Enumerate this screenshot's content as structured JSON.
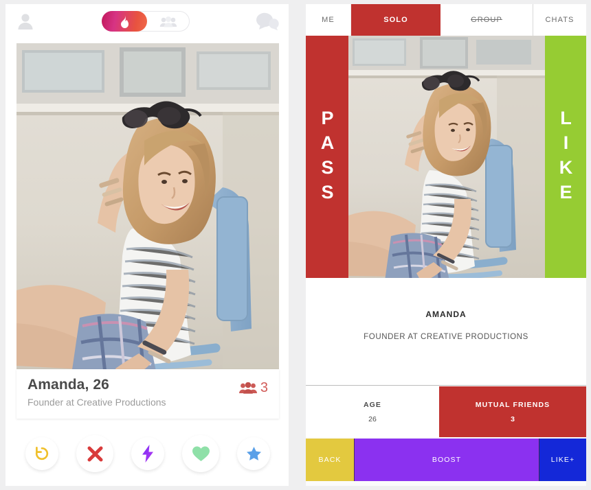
{
  "left_app": {
    "header": {
      "profile_icon": "person-icon",
      "chat_icon": "chat-bubbles-icon",
      "toggle": {
        "active_icon": "flame-icon",
        "inactive_icon": "group-people-icon"
      }
    },
    "card": {
      "name_line": "Amanda, 26",
      "sub_line": "Founder at Creative Productions",
      "mutual_friends_icon": "group-people-icon",
      "mutual_friends_count": "3",
      "photo_alt": "woman-seated-in-blue-chair-holding-sunglasses"
    },
    "actions": [
      {
        "name": "rewind-button",
        "icon": "rewind-icon",
        "color": "#f0c02c"
      },
      {
        "name": "nope-button",
        "icon": "x-icon",
        "color": "#d93b3b"
      },
      {
        "name": "boost-button",
        "icon": "lightning-bolt-icon",
        "color": "#9b32f0"
      },
      {
        "name": "like-button",
        "icon": "heart-icon",
        "color": "#8fe0a8"
      },
      {
        "name": "superlike-button",
        "icon": "star-icon",
        "color": "#5aa0e8"
      }
    ]
  },
  "right_app": {
    "tabs": [
      {
        "label": "ME",
        "state": "inactive"
      },
      {
        "label": "SOLO",
        "state": "active"
      },
      {
        "label": "GROUP",
        "state": "disabled"
      },
      {
        "label": "CHATS",
        "state": "inactive"
      }
    ],
    "hero": {
      "pass_label": "PASS",
      "like_label": "LIKE",
      "photo_alt": "woman-seated-in-blue-chair-holding-sunglasses"
    },
    "bio": {
      "name": "AMANDA",
      "role": "FOUNDER AT CREATIVE PRODUCTIONS"
    },
    "stats": [
      {
        "label": "AGE",
        "value": "26"
      },
      {
        "label": "MUTUAL FRIENDS",
        "value": "3"
      }
    ],
    "bottom_bar": [
      {
        "label": "BACK",
        "color": "#e3c93f"
      },
      {
        "label": "BOOST",
        "color": "#8b31f0"
      },
      {
        "label": "LIKE+",
        "color": "#1428d8"
      }
    ]
  },
  "colors": {
    "brand_red": "#c0322f",
    "like_green": "#96cc33",
    "boost_purple": "#8b31f0",
    "back_gold": "#e3c93f",
    "like_blue": "#1428d8",
    "page_bg": "#efeff0"
  }
}
